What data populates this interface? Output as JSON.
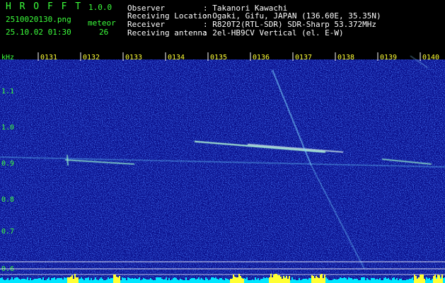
{
  "app": {
    "name": "H R O F F T",
    "version": "1.0.0"
  },
  "file": {
    "name": "2510020130.png",
    "datetime": "25.10.02 01:30"
  },
  "meteor": {
    "label": "meteor",
    "count": "26"
  },
  "info": [
    {
      "label": "Observer",
      "value": ": Takanori Kawachi"
    },
    {
      "label": "Receiving Location",
      "value": ": Ogaki, Gifu, JAPAN (136.60E, 35.35N)"
    },
    {
      "label": "Receiver",
      "value": ": R820T2(RTL-SDR) SDR-Sharp 53.372MHz"
    },
    {
      "label": "Receiving antenna",
      "value": ": 2el-HB9CV Vertical (el. E-W)"
    }
  ],
  "axis": {
    "unit": "kHz",
    "frequency_labels": [
      "1.1",
      "1.0",
      "0.9",
      "0.8",
      "0.7",
      "0.6"
    ],
    "time_labels": [
      "0131",
      "0132",
      "0133",
      "0134",
      "0135",
      "0136",
      "0137",
      "0138",
      "0139",
      "0140"
    ]
  },
  "colors": {
    "header_text": "#3cff3c",
    "info_text": "#ffffff",
    "background": "#000000",
    "spectrogram_base": "#0a0f8c",
    "signal": "#9fffd0",
    "noise_floor_cyan": "#00e6ff",
    "noise_floor_yellow": "#ffff33"
  }
}
